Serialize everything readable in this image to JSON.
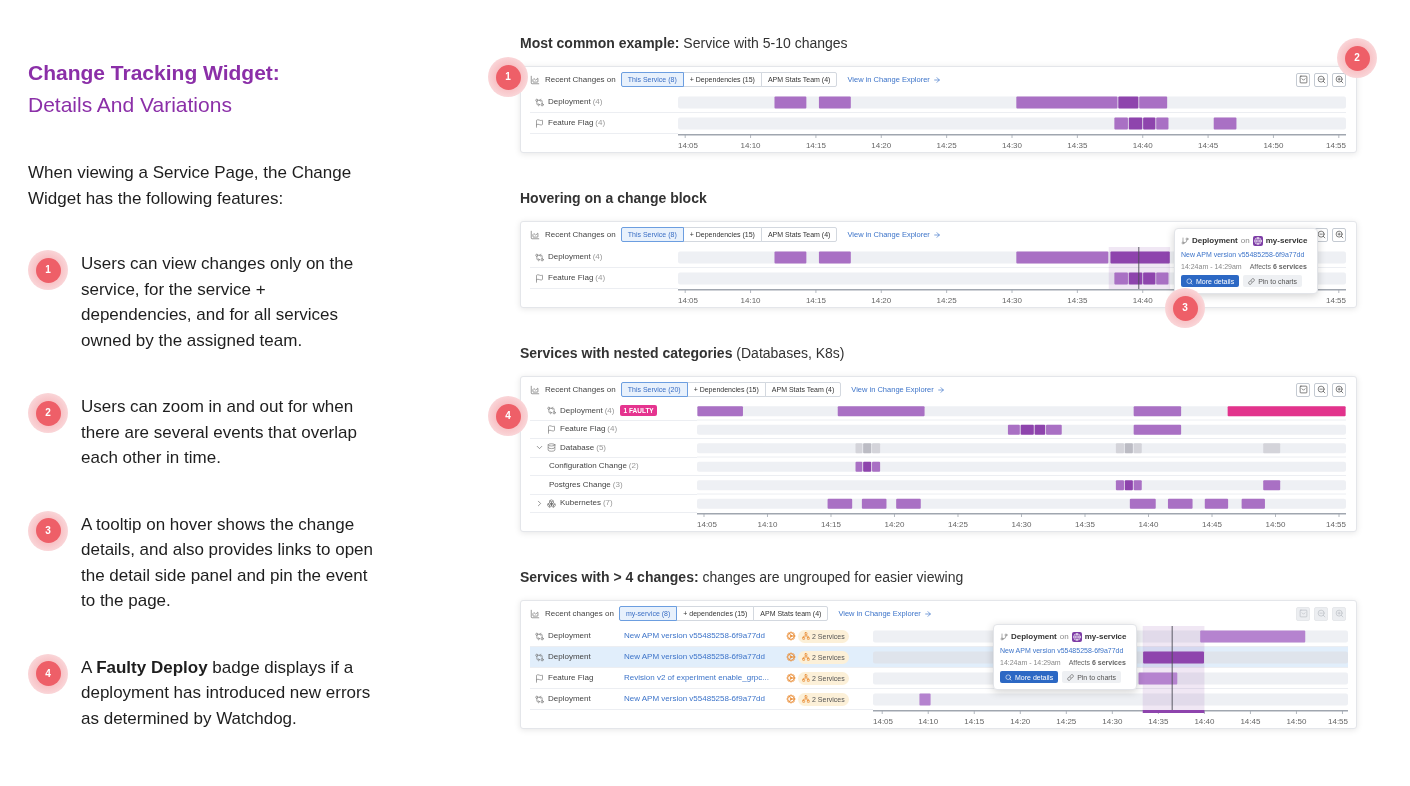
{
  "title": {
    "line_1": "Change Tracking Widget:",
    "line_2": "Details And Variations"
  },
  "intro": "When viewing a Service Page, the Change Widget has the following features:",
  "features": [
    {
      "number": "1",
      "text": "Users can view changes only on the service, for the service + dependencies, and for all services owned by the assigned team."
    },
    {
      "number": "2",
      "text": "Users can zoom in and out for when there are several events that overlap each other in time."
    },
    {
      "number": "3",
      "text": "A tooltip on hover shows the change details, and also provides links to open the detail side panel and pin the event to the page."
    },
    {
      "number": "4",
      "text": "A **Faulty Deploy** badge displays if a deployment has introduced new errors as determined by Watchdog."
    }
  ],
  "examples": [
    {
      "heading": {
        "text": "**Most common example:** Service with 5-10 changes",
        "bold": false
      },
      "markers": [
        {
          "number": "1",
          "kind": "header_left"
        },
        {
          "number": "2",
          "kind": "top_right"
        }
      ],
      "widget": {
        "kind": "grouped",
        "title": "Recent Changes on",
        "tabs": [
          {
            "label": "This Service (8)",
            "selected": true
          },
          {
            "label": "+ Dependencies (15)",
            "selected": false
          },
          {
            "label": "APM Stats Team (4)",
            "selected": false
          }
        ],
        "link": "View in Change Explorer",
        "controls": [
          {
            "kind": "chevron",
            "disabled": false
          },
          {
            "kind": "zoom_out",
            "disabled": false
          },
          {
            "kind": "zoom_in",
            "disabled": false
          }
        ],
        "rows": [
          {
            "kind": "deployment",
            "label": "Deployment",
            "count": "(4)"
          },
          {
            "kind": "feature_flag",
            "label": "Feature Flag",
            "count": "(4)"
          }
        ],
        "axis_labels": [
          "14:05",
          "14:10",
          "14:15",
          "14:20",
          "14:25",
          "14:30",
          "14:35",
          "14:40",
          "14:45",
          "14:50",
          "14:55"
        ]
      }
    },
    {
      "heading": {
        "text": "Hovering on a change block",
        "bold": true
      },
      "markers": [
        {
          "number": "3",
          "kind": "tooltip_bottom"
        }
      ],
      "widget": {
        "kind": "grouped",
        "title": "Recent Changes on",
        "tabs": [
          {
            "label": "This Service (8)",
            "selected": true
          },
          {
            "label": "+ Dependencies (15)",
            "selected": false
          },
          {
            "label": "APM Stats Team (4)",
            "selected": false
          }
        ],
        "link": "View in Change Explorer",
        "controls": [
          {
            "kind": "zoom_out",
            "disabled": false
          },
          {
            "kind": "zoom_in",
            "disabled": false
          }
        ],
        "rows": [
          {
            "kind": "deployment",
            "label": "Deployment",
            "count": "(4)"
          },
          {
            "kind": "feature_flag",
            "label": "Feature Flag",
            "count": "(4)"
          }
        ],
        "axis_labels": [
          "14:05",
          "14:10",
          "14:15",
          "14:20",
          "14:25",
          "14:30",
          "14:35",
          "14:40",
          "14:55"
        ],
        "tooltip": {
          "type": "Deployment",
          "connector": "on",
          "service": "my-service",
          "link": "New APM version v55485258-6f9a77dd",
          "time": "14:24am - 14:29am",
          "affects": "Affects **6 services**",
          "buttons": [
            {
              "kind": "primary",
              "label": "More details"
            },
            {
              "kind": "secondary",
              "label": "Pin to charts"
            }
          ]
        }
      }
    },
    {
      "heading": {
        "text": "**Services with nested categories** (Databases, K8s)",
        "bold": false
      },
      "markers": [
        {
          "number": "4",
          "kind": "row_left"
        }
      ],
      "widget": {
        "kind": "nested",
        "title": "Recent Changes on",
        "tabs": [
          {
            "label": "This Service (20)",
            "selected": true
          },
          {
            "label": "+ Dependencies (15)",
            "selected": false
          },
          {
            "label": "APM Stats Team (4)",
            "selected": false
          }
        ],
        "link": "View in Change Explorer",
        "controls": [
          {
            "kind": "chevron",
            "disabled": false
          },
          {
            "kind": "zoom_out",
            "disabled": false
          },
          {
            "kind": "zoom_in",
            "disabled": false
          }
        ],
        "rows": [
          {
            "kind": "deployment",
            "label": "Deployment",
            "count": "(4)",
            "badge": "1 FAULTY"
          },
          {
            "kind": "feature_flag",
            "label": "Feature Flag",
            "count": "(4)"
          },
          {
            "kind": "database",
            "label": "Database",
            "count": "(5)",
            "expanded": true,
            "children": [
              {
                "label": "Configuration Change",
                "count": "(2)"
              },
              {
                "label": "Postgres Change",
                "count": "(3)"
              }
            ]
          },
          {
            "kind": "kubernetes",
            "label": "Kubernetes",
            "count": "(7)",
            "expanded": false
          }
        ],
        "axis_labels": [
          "14:05",
          "14:10",
          "14:15",
          "14:20",
          "14:25",
          "14:30",
          "14:35",
          "14:40",
          "14:45",
          "14:50",
          "14:55"
        ]
      }
    },
    {
      "heading": {
        "text": "**Services with > 4 changes:** changes are ungrouped for easier viewing",
        "bold": false
      },
      "widget": {
        "kind": "ungrouped",
        "title": "Recent changes on",
        "tabs": [
          {
            "label": "my-service (8)",
            "selected": true
          },
          {
            "label": "+ dependencies (15)",
            "selected": false
          },
          {
            "label": "APM Stats team (4)",
            "selected": false
          }
        ],
        "link": "View in Change Explorer",
        "controls": [
          {
            "kind": "chevron",
            "disabled": true
          },
          {
            "kind": "zoom_out",
            "disabled": true
          },
          {
            "kind": "zoom_in",
            "disabled": true
          }
        ],
        "rows": [
          {
            "kind": "deployment",
            "label": "Deployment",
            "title": "New APM version v55485258-6f9a77dd",
            "services": "2 Services",
            "selected": false
          },
          {
            "kind": "deployment",
            "label": "Deployment",
            "title": "New APM version v55485258-6f9a77dd",
            "services": "2 Services",
            "selected": true
          },
          {
            "kind": "feature_flag",
            "label": "Feature Flag",
            "title": "Revision v2 of experiment enable_grpc...",
            "services": "2 Services",
            "selected": false
          },
          {
            "kind": "deployment",
            "label": "Deployment",
            "title": "New APM version v55485258-6f9a77dd",
            "services": "2 Services",
            "selected": false
          }
        ],
        "axis_labels": [
          "14:05",
          "14:10",
          "14:15",
          "14:20",
          "14:25",
          "14:30",
          "14:35",
          "14:40",
          "14:45",
          "14:50",
          "14:55"
        ],
        "tooltip": {
          "type": "Deployment",
          "connector": "on",
          "service": "my-service",
          "link": "New APM version v55485258-6f9a77dd",
          "time": "14:24am - 14:29am",
          "affects": "Affects **6 services**",
          "buttons": [
            {
              "kind": "primary",
              "label": "More details"
            },
            {
              "kind": "secondary",
              "label": "Pin to charts"
            }
          ]
        }
      }
    }
  ]
}
